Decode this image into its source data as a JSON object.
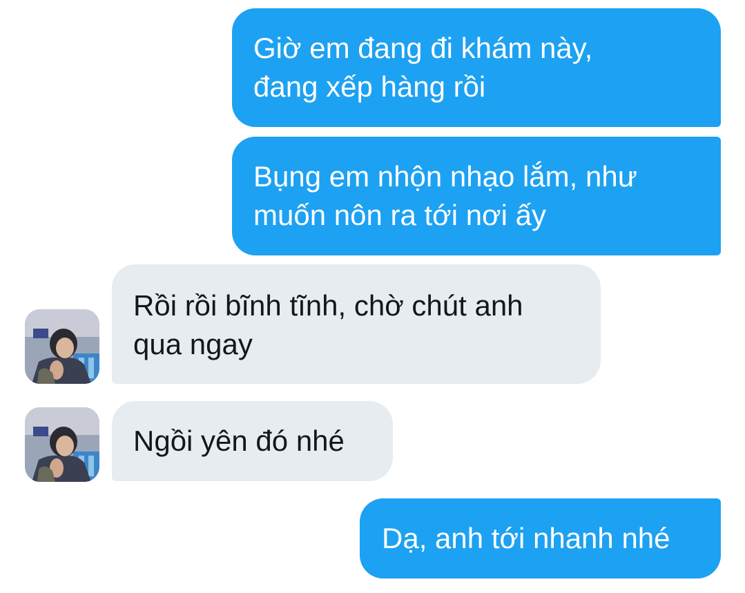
{
  "conversation": {
    "messages": [
      {
        "direction": "outgoing",
        "text": "Giờ em đang đi khám này,\nđang xếp hàng rồi"
      },
      {
        "direction": "outgoing",
        "text": "Bụng em nhộn nhạo lắm, như\nmuốn nôn ra tới nơi ấy"
      },
      {
        "direction": "incoming",
        "text": "Rồi rồi bĩnh tĩnh, chờ chút anh\nqua ngay"
      },
      {
        "direction": "incoming",
        "text": "Ngồi yên đó nhé"
      },
      {
        "direction": "outgoing",
        "text": "Dạ, anh tới nhanh nhé"
      }
    ]
  },
  "colors": {
    "outgoing_bubble": "#1da1f2",
    "incoming_bubble": "#e6ecf0",
    "outgoing_text": "#ffffff",
    "incoming_text": "#14171a"
  },
  "icons": {
    "avatar": "user-avatar-photo"
  }
}
